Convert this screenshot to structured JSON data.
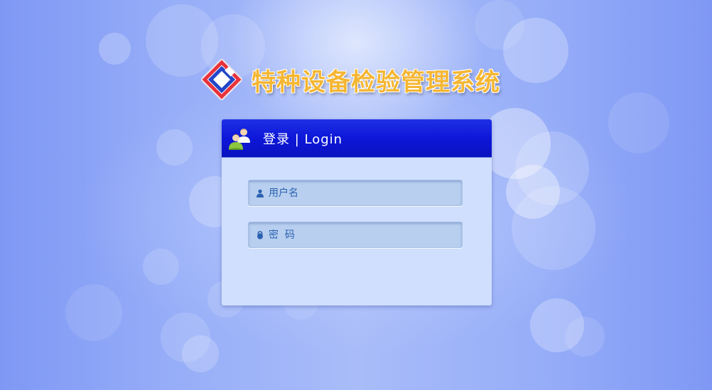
{
  "app": {
    "title": "特种设备检验管理系统"
  },
  "login_panel": {
    "title": "登录 | Login",
    "username": {
      "placeholder": "用户名",
      "value": ""
    },
    "password": {
      "placeholder": "密  码",
      "value": ""
    }
  },
  "icons": {
    "logo": "diamond-logo-icon",
    "header": "users-icon",
    "username": "user-icon",
    "password": "lock-icon"
  },
  "colors": {
    "title_text": "#f5b632",
    "panel_header": "#0d17d8",
    "panel_body": "#cfdffd",
    "input_bg": "#b8cfef",
    "placeholder_text": "#2b62b0",
    "logo_red": "#e8323c",
    "logo_blue": "#2146c8"
  }
}
